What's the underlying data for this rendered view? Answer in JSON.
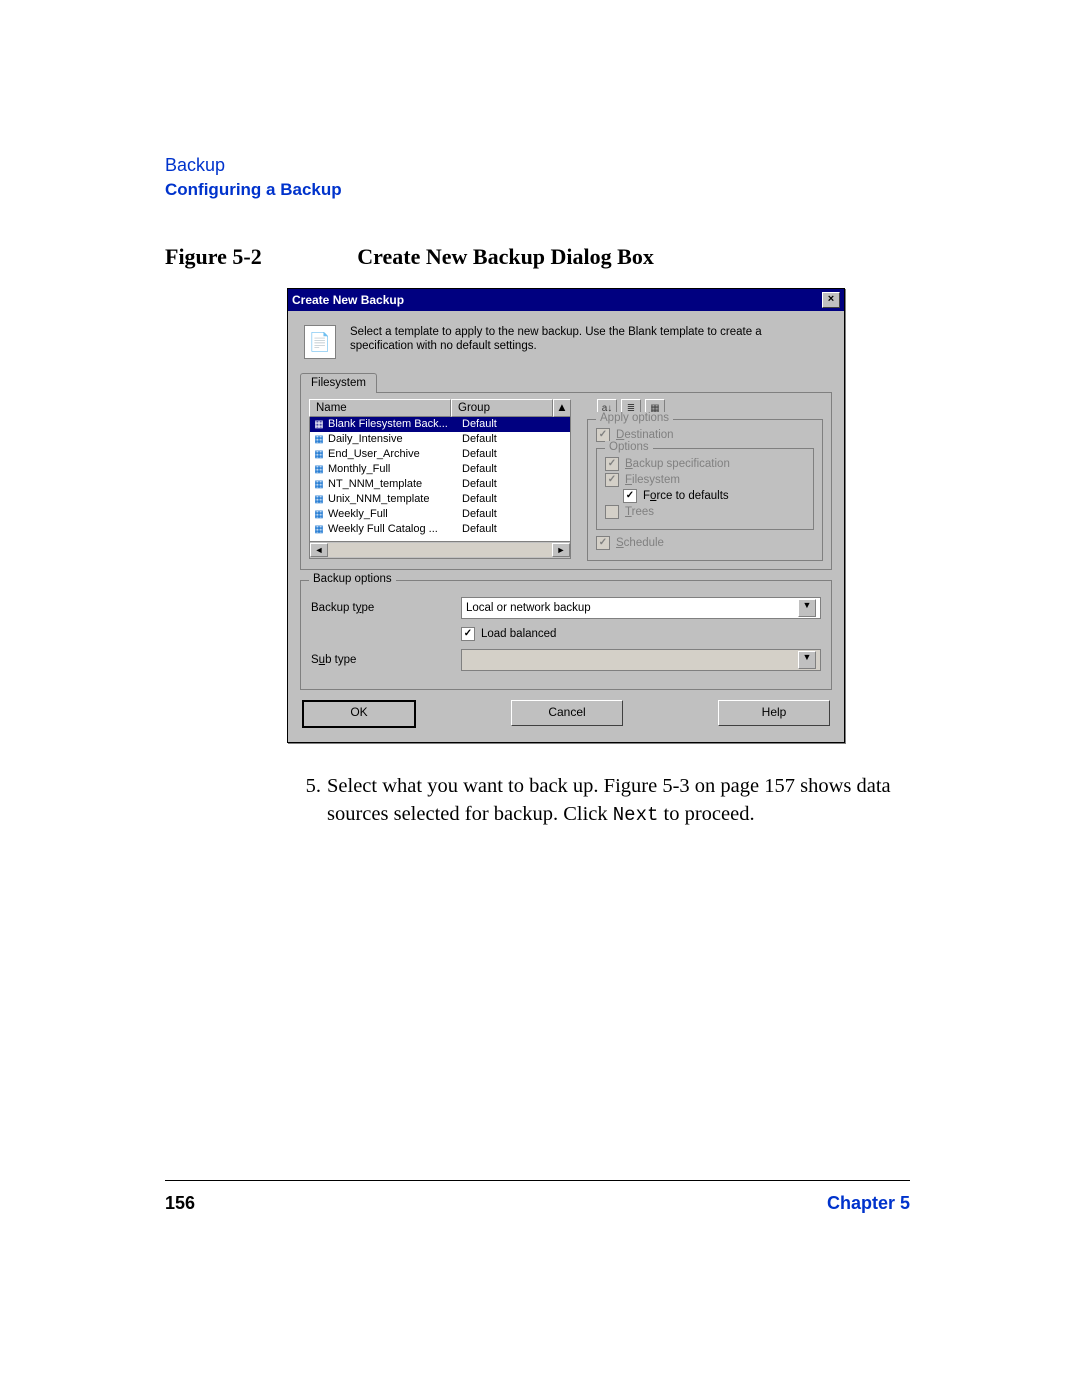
{
  "header": {
    "section_link": "Backup",
    "section_title": "Configuring a Backup"
  },
  "figure": {
    "label": "Figure 5-2",
    "caption": "Create New Backup Dialog Box"
  },
  "dialog": {
    "title": "Create New Backup",
    "intro": "Select a template to apply to the new backup. Use the Blank template to create a specification with no default settings.",
    "tab": "Filesystem",
    "columns": {
      "name": "Name",
      "group": "Group"
    },
    "templates": [
      {
        "name": "Blank Filesystem Back...",
        "group": "Default",
        "selected": true
      },
      {
        "name": "Daily_Intensive",
        "group": "Default"
      },
      {
        "name": "End_User_Archive",
        "group": "Default"
      },
      {
        "name": "Monthly_Full",
        "group": "Default"
      },
      {
        "name": "NT_NNM_template",
        "group": "Default"
      },
      {
        "name": "Unix_NNM_template",
        "group": "Default"
      },
      {
        "name": "Weekly_Full",
        "group": "Default"
      },
      {
        "name": "Weekly Full Catalog ...",
        "group": "Default"
      }
    ],
    "apply_options": {
      "title": "Apply options",
      "destination": "Destination",
      "options_title": "Options",
      "backup_spec": "Backup specification",
      "filesystem": "Filesystem",
      "force_defaults": "Force to defaults",
      "trees": "Trees",
      "schedule": "Schedule"
    },
    "backup_options": {
      "title": "Backup options",
      "backup_type_label": "Backup type",
      "backup_type_value": "Local or network backup",
      "load_balanced": "Load balanced",
      "sub_type_label": "Sub type",
      "sub_type_value": ""
    },
    "buttons": {
      "ok": "OK",
      "cancel": "Cancel",
      "help": "Help"
    }
  },
  "body_text": {
    "item_no": "5.",
    "line1a": "Select what you want to back up. Figure 5-3 on page 157 shows data",
    "line2a": "sources selected for backup. Click ",
    "mono": "Next",
    "line2b": " to proceed."
  },
  "footer": {
    "page": "156",
    "chapter": "Chapter 5"
  }
}
